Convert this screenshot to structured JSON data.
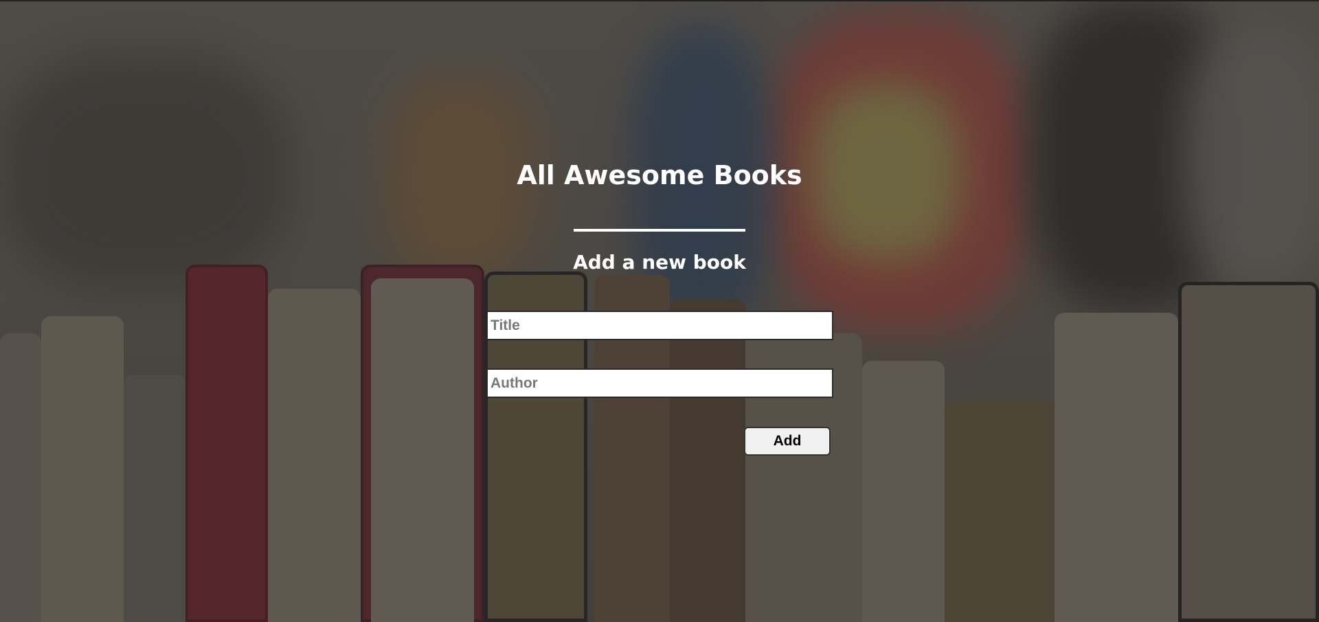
{
  "header": {
    "title": "All Awesome Books"
  },
  "form": {
    "heading": "Add a new book",
    "title_placeholder": "Title",
    "title_value": "",
    "author_placeholder": "Author",
    "author_value": "",
    "submit_label": "Add"
  },
  "colors": {
    "text": "#ffffff",
    "overlay": "#3a3733",
    "button_bg": "#f0f0f0",
    "input_border": "#2b2b2b"
  }
}
